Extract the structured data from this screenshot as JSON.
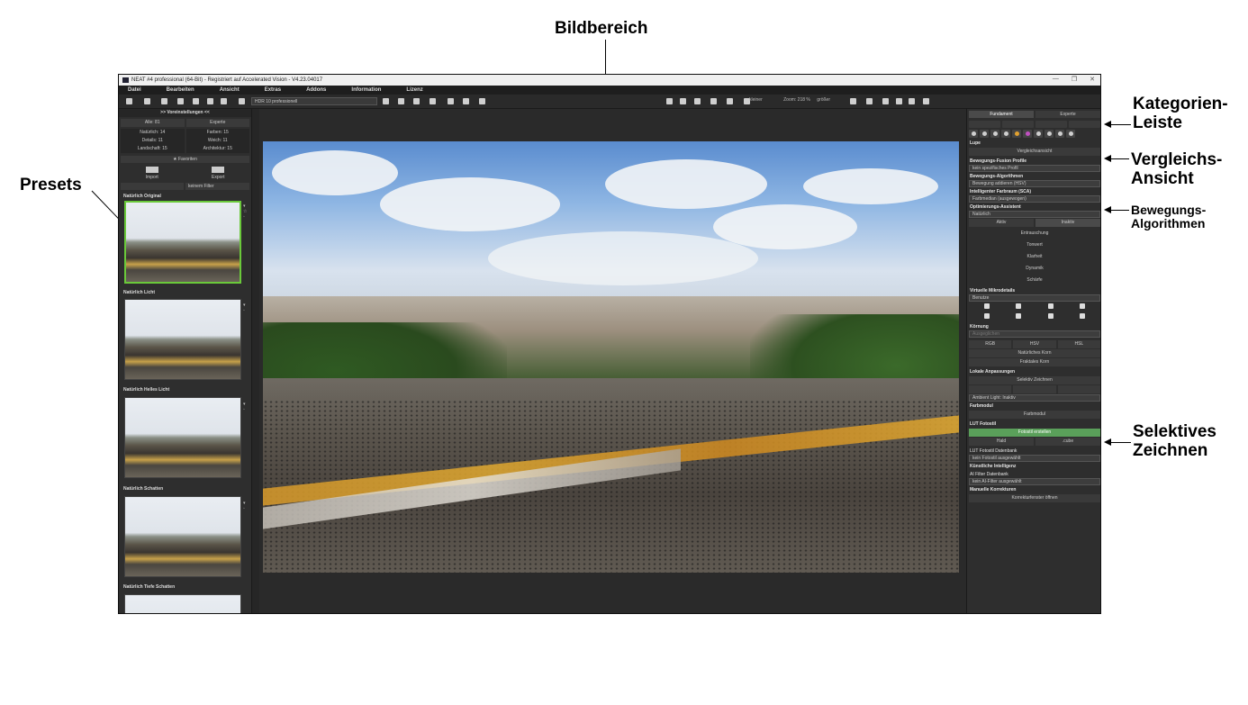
{
  "callouts": {
    "bildbereich": "Bildbereich",
    "presets": "Presets",
    "kategorien": "Kategorien-",
    "kategorien2": "Leiste",
    "vergleichs": "Vergleichs-",
    "vergleichs2": "Ansicht",
    "bewegungs": "Bewegungs-",
    "bewegungs2": "Algorithmen",
    "selektives": "Selektives",
    "selektives2": "Zeichnen"
  },
  "window": {
    "title": "NEAT #4 professional (64-Bit) - Registriert auf Accelerated Vision - V4.23.04017"
  },
  "menu": [
    "Datei",
    "Bearbeiten",
    "Ansicht",
    "Extras",
    "Addons",
    "Information",
    "Lizenz"
  ],
  "toolbar": {
    "profile_select": "HDR 10 professionell",
    "zoom_label": "kleiner",
    "zoom_value": "Zoom: 218 %",
    "zoom_right": "größer"
  },
  "left": {
    "header": ">> Voreinstellungen <<",
    "all": "Alle: 81",
    "expert": "Experte",
    "cells": [
      [
        "Natürlich: 14",
        "Farben: 15"
      ],
      [
        "Details: 11",
        "Weich: 11"
      ],
      [
        "Landschaft: 15",
        "Architektur: 15"
      ]
    ],
    "favorites": "★ Favoriten",
    "import": "Import",
    "export": "Export",
    "filter": "keinem Filter",
    "presets": [
      "Natürlich Original",
      "Natürlich Licht",
      "Natürlich Helles Licht",
      "Natürlich Schatten",
      "Natürlich Tiefe Schatten"
    ]
  },
  "right": {
    "tab_basic": "Fundament",
    "tab_expert": "Experte",
    "loupe": "Lupe",
    "compare": "Vergleichsansicht",
    "fusion_title": "Bewegungs-Fusion Profile",
    "fusion_value": "kein spezifisches Profil",
    "algo_title": "Bewegungs-Algorithmen",
    "algo_value": "Bewegung addieren (HSV)",
    "sca_title": "Intelligenter Farbraum (SCA)",
    "sca_value": "Farbmedian (ausgewogen)",
    "assist_title": "Optimierungs-Assistent",
    "assist_value": "Natürlich",
    "active": "Aktiv",
    "inactive": "Inaktiv",
    "sliders": [
      "Entrauschung",
      "Tonwert",
      "Klarheit",
      "Dynamik",
      "Schärfe"
    ],
    "micro_title": "Virtuelle Mikrodetails",
    "micro_value": "Benutze",
    "grain_title": "Körnung",
    "grain_value": "Ausgeglichen",
    "rgb": "RGB",
    "hsv": "HSV",
    "hsl": "HSL",
    "natural_grain": "Natürliches Korn",
    "fractal_grain": "Fraktales Korn",
    "local_title": "Lokale Anpassungen",
    "selective": "Selektiv Zeichnen",
    "ambient": "Ambient Light: Inaktiv",
    "color_title": "Farbmodul",
    "color_btn": "Farbmodul",
    "lut_title": "LUT Fotostil",
    "lut_btn": "Fotostil erstellen",
    "hald": "Hald",
    "cube": ".cube",
    "lut_db": "LUT Fotostil Datenbank",
    "lut_db_value": "kein Fotostil ausgewählt",
    "ai_title": "Künstliche Intelligenz",
    "ai_db": "AI Filter Datenbank",
    "ai_value": "kein AI-Filter ausgewählt",
    "manual_title": "Manuelle Korrekturen",
    "manual_btn": "Korrekturfenster öffnen"
  }
}
